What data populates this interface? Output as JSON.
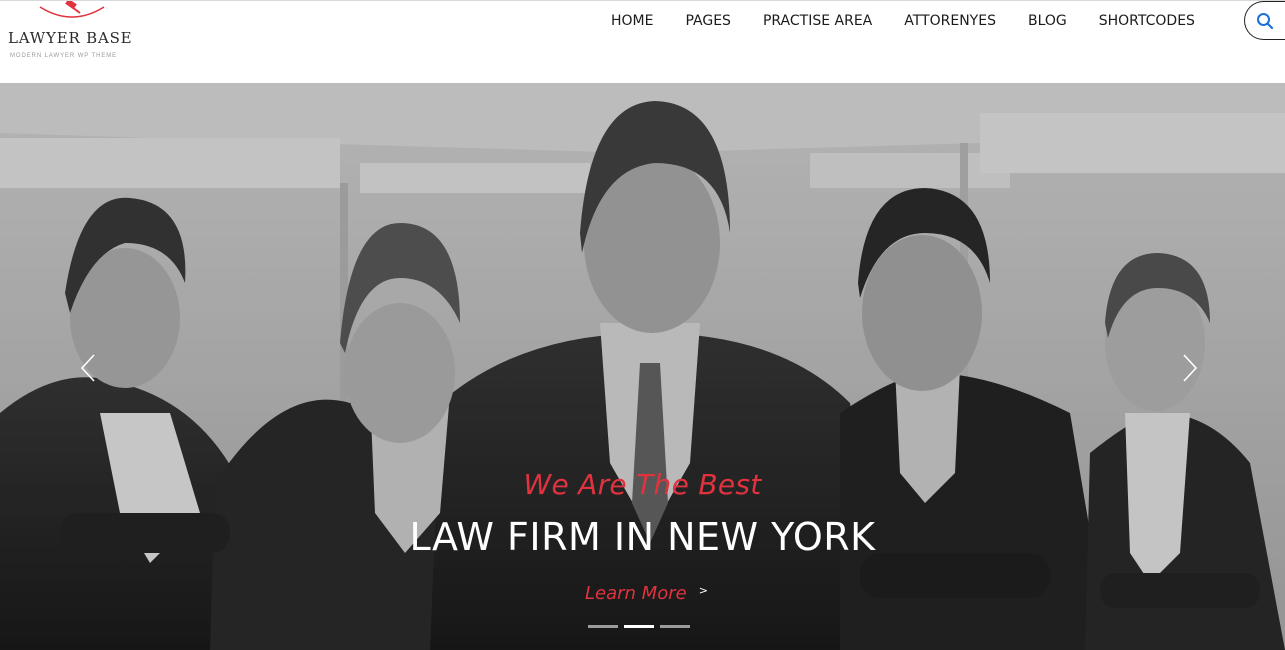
{
  "brand": {
    "title": "LAWYER BASE",
    "subtitle": "MODERN LAWYER WP THEME",
    "accent_color": "#e0323f"
  },
  "nav": {
    "items": [
      {
        "label": "HOME"
      },
      {
        "label": "PAGES"
      },
      {
        "label": "PRACTISE AREA"
      },
      {
        "label": "ATTORENYES"
      },
      {
        "label": "BLOG"
      },
      {
        "label": "SHORTCODES"
      }
    ],
    "search_icon": "search-icon"
  },
  "hero": {
    "tagline": "We Are The Best",
    "headline": "LAW FIRM IN NEW YORK",
    "cta_label": "Learn More",
    "cta_arrow": ">",
    "prev_icon": "chevron-left-icon",
    "next_icon": "chevron-right-icon",
    "slides": [
      {
        "active": false
      },
      {
        "active": true
      },
      {
        "active": false
      }
    ]
  }
}
